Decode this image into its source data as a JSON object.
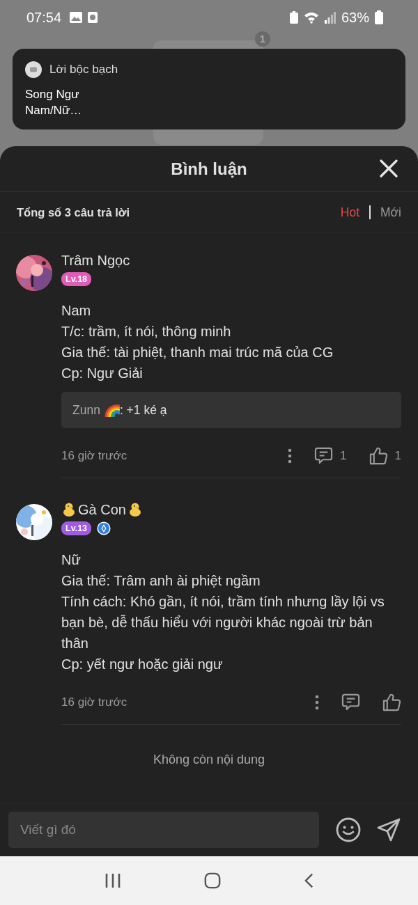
{
  "status_bar": {
    "time": "07:54",
    "battery": "63%"
  },
  "background": {
    "badge": "1"
  },
  "notification": {
    "app": "Lời bộc bạch",
    "title": "Song Ngư",
    "text": "Nam/Nữ…"
  },
  "sheet": {
    "title": "Bình luận",
    "total": "Tổng số 3 câu trả lời",
    "sort_tabs": [
      {
        "label": "Hot",
        "selected": true
      },
      {
        "label": "Mới",
        "selected": false
      }
    ]
  },
  "comments": [
    {
      "name": "Trâm Ngọc",
      "decorated": false,
      "level": "Lv.18",
      "color": "#e45bb5",
      "verified": false,
      "lines": [
        "Nam",
        "T/c: trầm, ít nói, thông minh",
        "Gia thế: tài phiệt, thanh mai trúc mã của CG",
        "Cp: Ngư Giải"
      ],
      "reply": {
        "author": "Zunn",
        "text": ": +1 ké ạ"
      },
      "time": "16 giờ trước",
      "replies": "1",
      "likes": "1"
    },
    {
      "name": "Gà Con",
      "decorated": true,
      "level": "Lv.13",
      "color": "#a05ce0",
      "verified": true,
      "lines": [
        "Nữ",
        "Gia thế: Trâm anh ài phiệt ngầm",
        "Tính cách: Khó gần, ít nói, trầm tính nhưng lầy lội vs bạn bè, dễ thấu hiểu với người khác ngoài trừ bản thân",
        "Cp: yết ngư hoặc giải ngư"
      ],
      "time": "16 giờ trước"
    }
  ],
  "end_text": "Không còn nội dung",
  "composer": {
    "placeholder": "Viết gì đó"
  }
}
